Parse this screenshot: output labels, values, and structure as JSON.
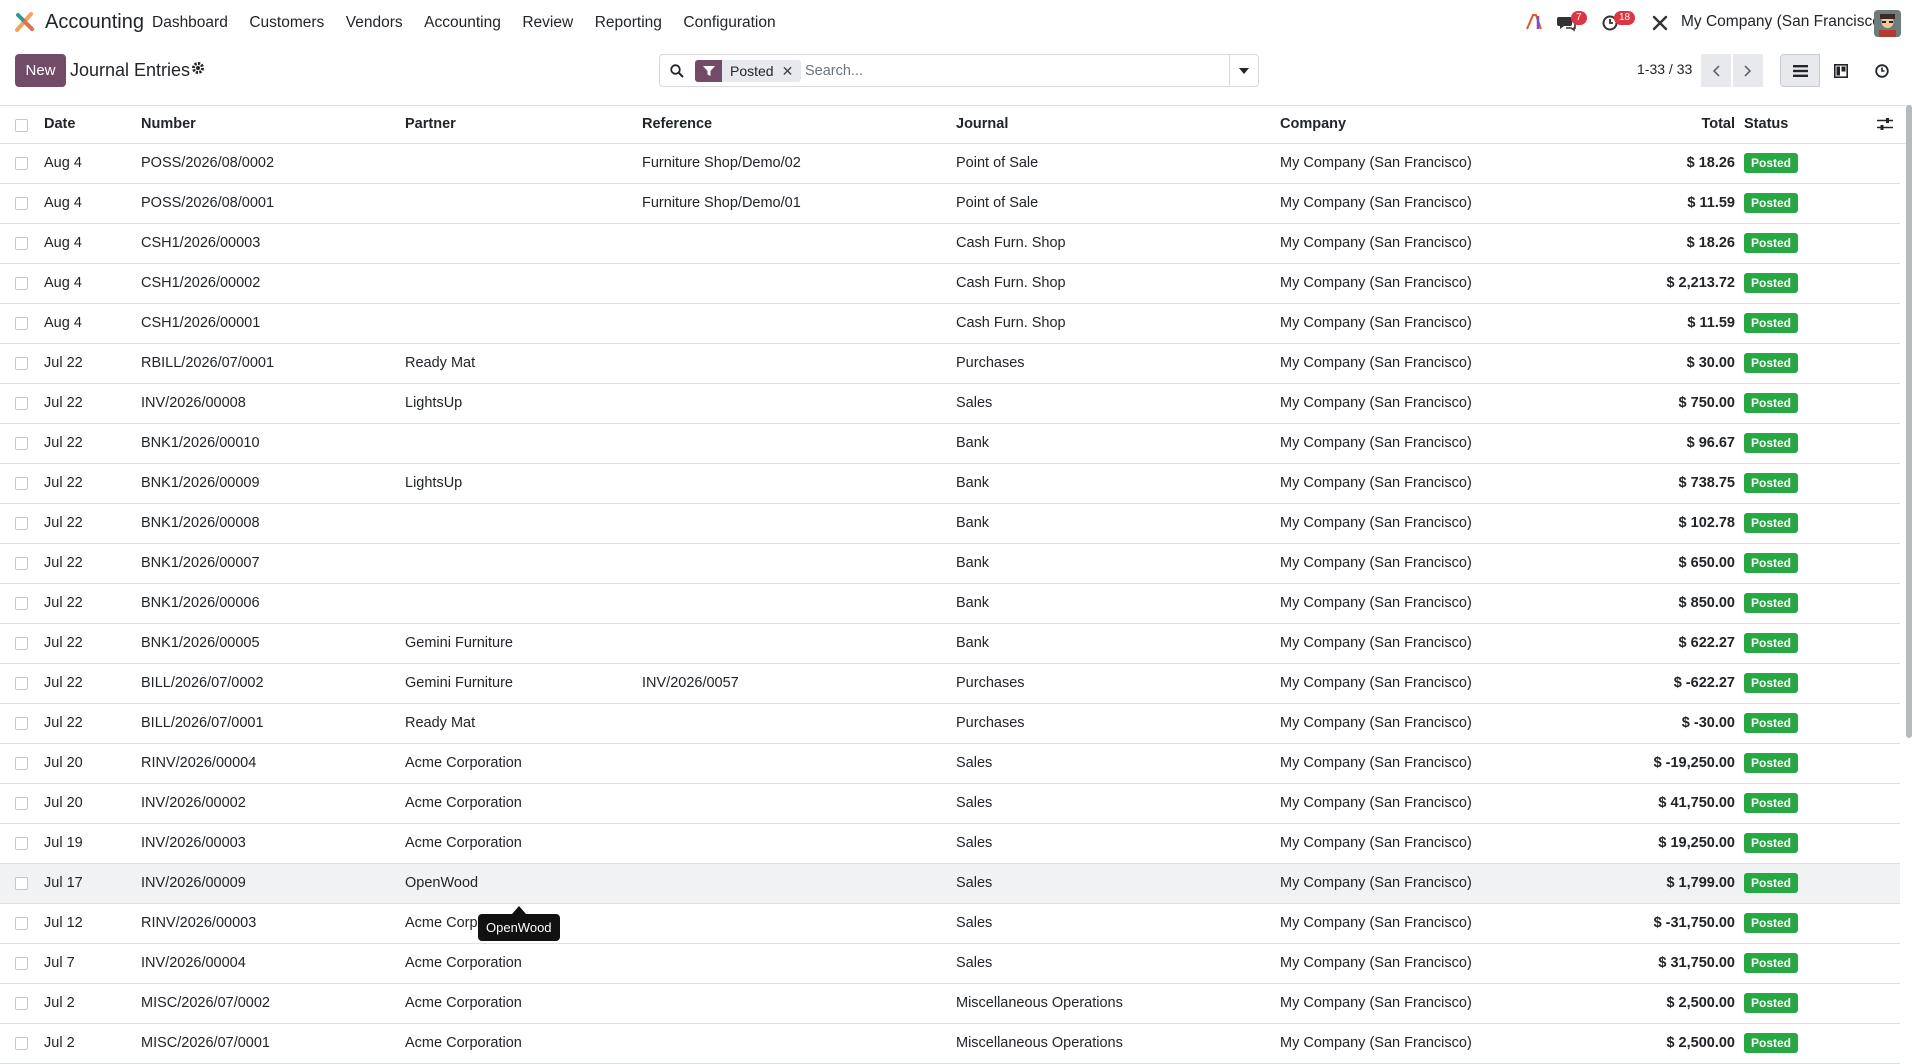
{
  "app": {
    "name": "Accounting",
    "icon": "accounting-app-icon"
  },
  "menu": [
    "Dashboard",
    "Customers",
    "Vendors",
    "Accounting",
    "Review",
    "Reporting",
    "Configuration"
  ],
  "systray": {
    "messages_count": "7",
    "activities_count": "18",
    "company": "My Company (San Francisco)"
  },
  "control": {
    "new_label": "New",
    "breadcrumb": "Journal Entries",
    "facet": "Posted",
    "search_placeholder": "Search...",
    "pager": "1-33 / 33"
  },
  "columns": {
    "date": "Date",
    "number": "Number",
    "partner": "Partner",
    "reference": "Reference",
    "journal": "Journal",
    "company": "Company",
    "total": "Total",
    "status": "Status"
  },
  "rows": [
    {
      "date": "Aug 4",
      "number": "POSS/2026/08/0002",
      "partner": "",
      "reference": "Furniture Shop/Demo/02",
      "journal": "Point of Sale",
      "company": "My Company (San Francisco)",
      "total": "$ 18.26",
      "status": "Posted"
    },
    {
      "date": "Aug 4",
      "number": "POSS/2026/08/0001",
      "partner": "",
      "reference": "Furniture Shop/Demo/01",
      "journal": "Point of Sale",
      "company": "My Company (San Francisco)",
      "total": "$ 11.59",
      "status": "Posted"
    },
    {
      "date": "Aug 4",
      "number": "CSH1/2026/00003",
      "partner": "",
      "reference": "",
      "journal": "Cash Furn. Shop",
      "company": "My Company (San Francisco)",
      "total": "$ 18.26",
      "status": "Posted"
    },
    {
      "date": "Aug 4",
      "number": "CSH1/2026/00002",
      "partner": "",
      "reference": "",
      "journal": "Cash Furn. Shop",
      "company": "My Company (San Francisco)",
      "total": "$ 2,213.72",
      "status": "Posted"
    },
    {
      "date": "Aug 4",
      "number": "CSH1/2026/00001",
      "partner": "",
      "reference": "",
      "journal": "Cash Furn. Shop",
      "company": "My Company (San Francisco)",
      "total": "$ 11.59",
      "status": "Posted"
    },
    {
      "date": "Jul 22",
      "number": "RBILL/2026/07/0001",
      "partner": "Ready Mat",
      "reference": "",
      "journal": "Purchases",
      "company": "My Company (San Francisco)",
      "total": "$ 30.00",
      "status": "Posted"
    },
    {
      "date": "Jul 22",
      "number": "INV/2026/00008",
      "partner": "LightsUp",
      "reference": "",
      "journal": "Sales",
      "company": "My Company (San Francisco)",
      "total": "$ 750.00",
      "status": "Posted"
    },
    {
      "date": "Jul 22",
      "number": "BNK1/2026/00010",
      "partner": "",
      "reference": "",
      "journal": "Bank",
      "company": "My Company (San Francisco)",
      "total": "$ 96.67",
      "status": "Posted"
    },
    {
      "date": "Jul 22",
      "number": "BNK1/2026/00009",
      "partner": "LightsUp",
      "reference": "",
      "journal": "Bank",
      "company": "My Company (San Francisco)",
      "total": "$ 738.75",
      "status": "Posted"
    },
    {
      "date": "Jul 22",
      "number": "BNK1/2026/00008",
      "partner": "",
      "reference": "",
      "journal": "Bank",
      "company": "My Company (San Francisco)",
      "total": "$ 102.78",
      "status": "Posted"
    },
    {
      "date": "Jul 22",
      "number": "BNK1/2026/00007",
      "partner": "",
      "reference": "",
      "journal": "Bank",
      "company": "My Company (San Francisco)",
      "total": "$ 650.00",
      "status": "Posted"
    },
    {
      "date": "Jul 22",
      "number": "BNK1/2026/00006",
      "partner": "",
      "reference": "",
      "journal": "Bank",
      "company": "My Company (San Francisco)",
      "total": "$ 850.00",
      "status": "Posted"
    },
    {
      "date": "Jul 22",
      "number": "BNK1/2026/00005",
      "partner": "Gemini Furniture",
      "reference": "",
      "journal": "Bank",
      "company": "My Company (San Francisco)",
      "total": "$ 622.27",
      "status": "Posted"
    },
    {
      "date": "Jul 22",
      "number": "BILL/2026/07/0002",
      "partner": "Gemini Furniture",
      "reference": "INV/2026/0057",
      "journal": "Purchases",
      "company": "My Company (San Francisco)",
      "total": "$ -622.27",
      "status": "Posted"
    },
    {
      "date": "Jul 22",
      "number": "BILL/2026/07/0001",
      "partner": "Ready Mat",
      "reference": "",
      "journal": "Purchases",
      "company": "My Company (San Francisco)",
      "total": "$ -30.00",
      "status": "Posted"
    },
    {
      "date": "Jul 20",
      "number": "RINV/2026/00004",
      "partner": "Acme Corporation",
      "reference": "",
      "journal": "Sales",
      "company": "My Company (San Francisco)",
      "total": "$ -19,250.00",
      "status": "Posted"
    },
    {
      "date": "Jul 20",
      "number": "INV/2026/00002",
      "partner": "Acme Corporation",
      "reference": "",
      "journal": "Sales",
      "company": "My Company (San Francisco)",
      "total": "$ 41,750.00",
      "status": "Posted"
    },
    {
      "date": "Jul 19",
      "number": "INV/2026/00003",
      "partner": "Acme Corporation",
      "reference": "",
      "journal": "Sales",
      "company": "My Company (San Francisco)",
      "total": "$ 19,250.00",
      "status": "Posted"
    },
    {
      "date": "Jul 17",
      "number": "INV/2026/00009",
      "partner": "OpenWood",
      "reference": "",
      "journal": "Sales",
      "company": "My Company (San Francisco)",
      "total": "$ 1,799.00",
      "status": "Posted"
    },
    {
      "date": "Jul 12",
      "number": "RINV/2026/00003",
      "partner": "Acme Corp",
      "reference": "",
      "journal": "Sales",
      "company": "My Company (San Francisco)",
      "total": "$ -31,750.00",
      "status": "Posted"
    },
    {
      "date": "Jul 7",
      "number": "INV/2026/00004",
      "partner": "Acme Corporation",
      "reference": "",
      "journal": "Sales",
      "company": "My Company (San Francisco)",
      "total": "$ 31,750.00",
      "status": "Posted"
    },
    {
      "date": "Jul 2",
      "number": "MISC/2026/07/0002",
      "partner": "Acme Corporation",
      "reference": "",
      "journal": "Miscellaneous Operations",
      "company": "My Company (San Francisco)",
      "total": "$ 2,500.00",
      "status": "Posted"
    },
    {
      "date": "Jul 2",
      "number": "MISC/2026/07/0001",
      "partner": "Acme Corporation",
      "reference": "",
      "journal": "Miscellaneous Operations",
      "company": "My Company (San Francisco)",
      "total": "$ 2,500.00",
      "status": "Posted"
    }
  ],
  "tooltip": "OpenWood",
  "colors": {
    "brand": "#714b67",
    "posted": "#28a745",
    "badge": "#dc3545"
  }
}
